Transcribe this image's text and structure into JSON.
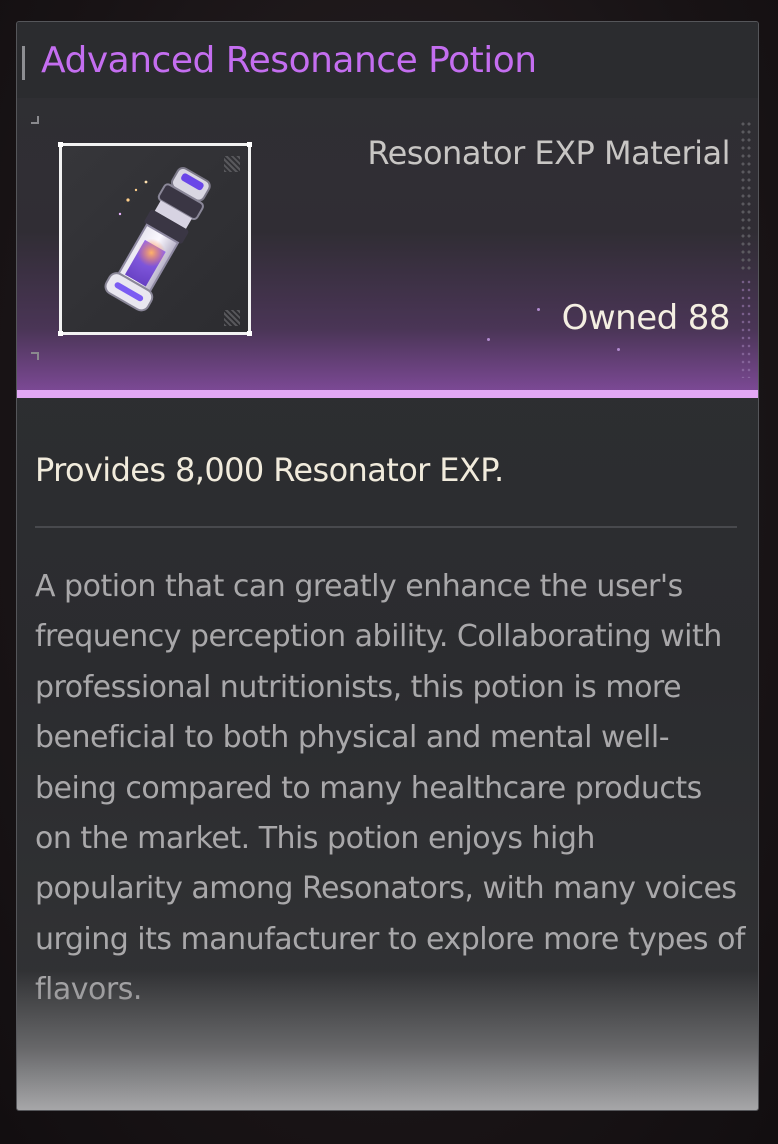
{
  "item": {
    "name": "Advanced Resonance Potion",
    "category": "Resonator EXP Material",
    "owned_label": "Owned",
    "owned_count": "88",
    "effect": "Provides 8,000 Resonator EXP.",
    "description": "A potion that can greatly enhance the user's frequency perception ability. Collaborating with professional nutritionists, this potion is more beneficial to both physical and mental well-being compared to many healthcare products on the market. This potion enjoys high popularity among Resonators, with many voices urging its manufacturer to explore more types of flavors."
  },
  "icons": {
    "item_icon": "purple-potion-vial-icon"
  },
  "colors": {
    "rarity_accent": "#c46ef0",
    "rarity_strip": "#e3a8f5",
    "owned_text": "#f4efe2"
  }
}
